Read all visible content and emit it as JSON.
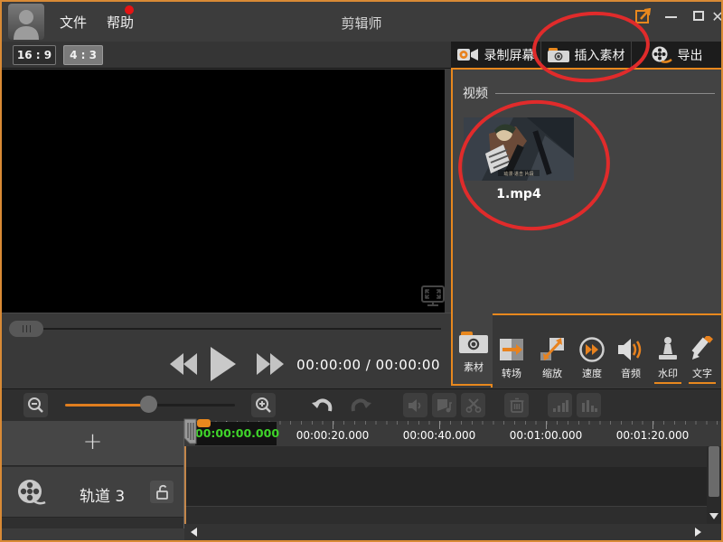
{
  "window": {
    "title": "剪辑师",
    "menu": [
      {
        "label": "文件"
      },
      {
        "label": "帮助",
        "notification_dot": true
      }
    ],
    "controls": {
      "close": "✕"
    }
  },
  "aspect": {
    "wide": "16 : 9",
    "narrow": "4 : 3"
  },
  "player": {
    "time_display": "00:00:00 / 00:00:00"
  },
  "tabs": [
    {
      "label": "录制屏幕",
      "icon": "record-screen-icon"
    },
    {
      "label": "插入素材",
      "icon": "insert-material-icon"
    },
    {
      "label": "导出",
      "icon": "export-icon"
    }
  ],
  "library": {
    "section_title": "视频",
    "items": [
      {
        "name": "1.mp4"
      }
    ]
  },
  "tools": [
    {
      "label": "素材",
      "active": true
    },
    {
      "label": "转场"
    },
    {
      "label": "缩放"
    },
    {
      "label": "速度"
    },
    {
      "label": "音频"
    },
    {
      "label": "水印",
      "highlight": true
    },
    {
      "label": "文字",
      "highlight": true
    }
  ],
  "timeline": {
    "current_time": "00:00:00.000",
    "ruler_labels": [
      "00:00:00.000",
      "00:00:20.000",
      "00:00:40.000",
      "00:01:00.000",
      "00:01:20.000"
    ],
    "add_track_label": "+",
    "track_label": "轨道 3"
  },
  "icons": {
    "annotation": "red-ellipse-markup",
    "colors": {
      "accent": "#E8821E",
      "window_border": "#D98A35",
      "annotation": "#E02B2B",
      "current_time_green": "#3FD42A"
    }
  }
}
